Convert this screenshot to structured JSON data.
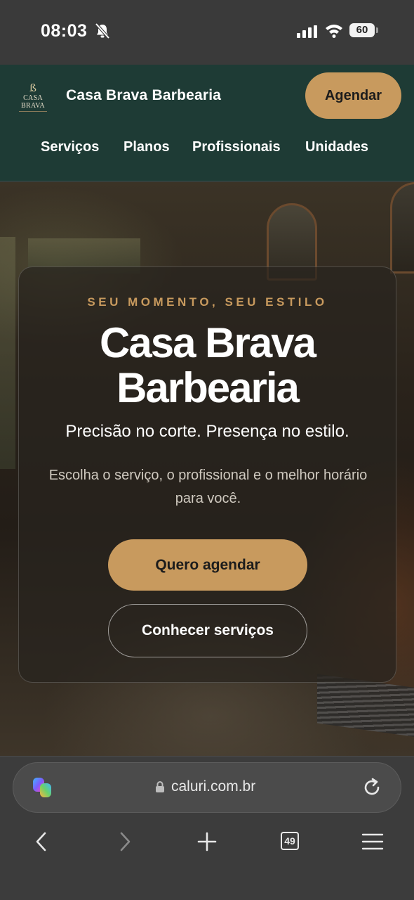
{
  "status_bar": {
    "time": "08:03",
    "battery": "60"
  },
  "site": {
    "logo_text": "CASA BRAVA",
    "brand_name": "Casa Brava Barbearia",
    "header_cta": "Agendar",
    "nav": [
      "Serviços",
      "Planos",
      "Profissionais",
      "Unidades"
    ]
  },
  "hero": {
    "eyebrow": "SEU MOMENTO, SEU ESTILO",
    "title_line1": "Casa Brava",
    "title_line2": "Barbearia",
    "tagline": "Precisão no corte. Presença no estilo.",
    "description": "Escolha o serviço, o profissional e o melhor horário para você.",
    "primary_button": "Quero agendar",
    "secondary_button": "Conhecer serviços"
  },
  "browser": {
    "url": "caluri.com.br",
    "tabs_count": "49"
  },
  "colors": {
    "header_bg": "#1e3b35",
    "accent_gold": "#c89a5e",
    "chrome_bg": "#3a3a3a"
  }
}
